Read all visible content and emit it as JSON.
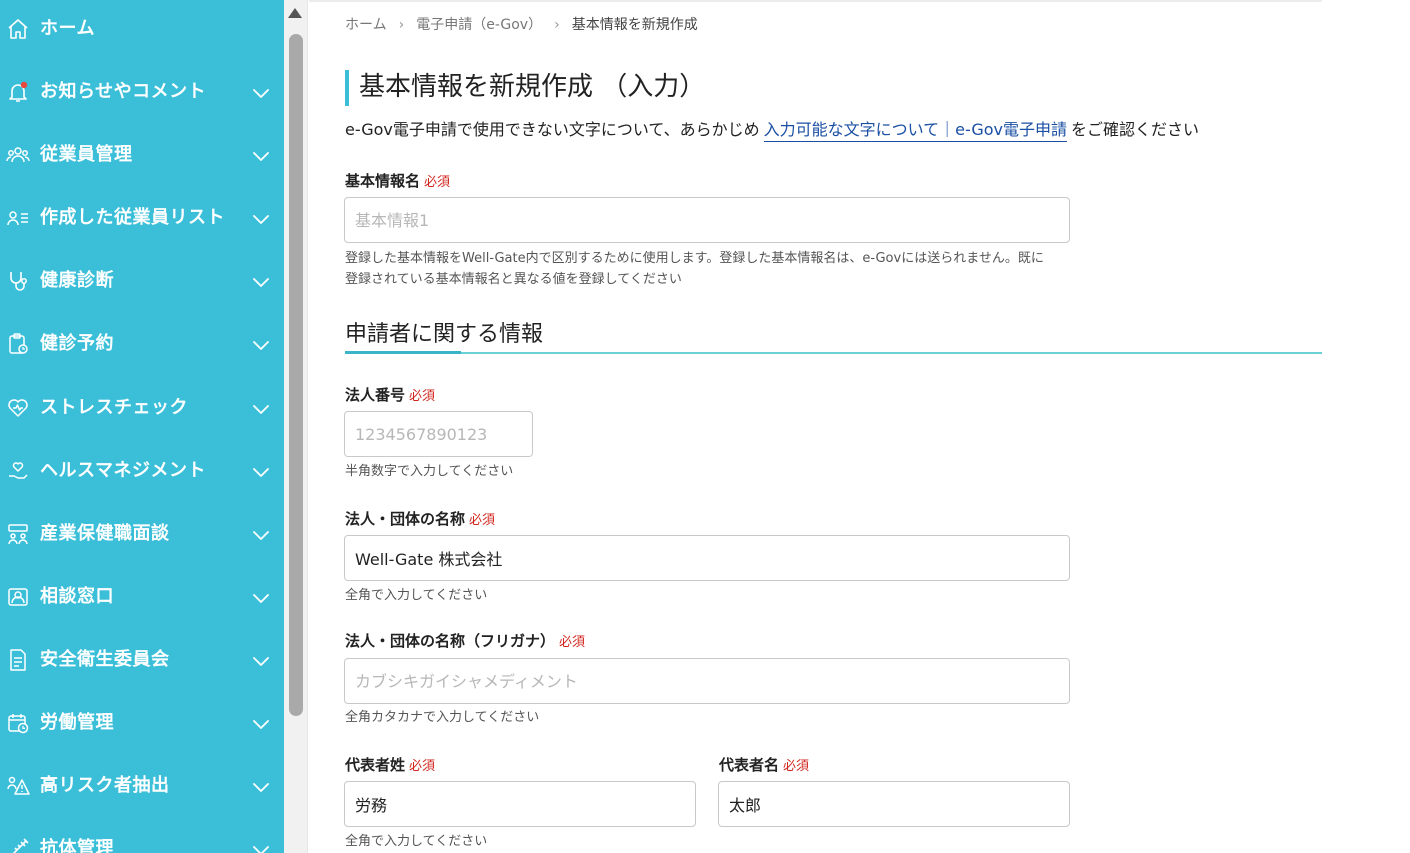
{
  "sidebar": {
    "items": [
      {
        "label": "ホーム",
        "icon": "home-icon"
      },
      {
        "label": "お知らせやコメント",
        "icon": "bell-icon"
      },
      {
        "label": "従業員管理",
        "icon": "users-icon"
      },
      {
        "label": "作成した従業員リスト",
        "icon": "user-list-icon"
      },
      {
        "label": "健康診断",
        "icon": "stethoscope-icon"
      },
      {
        "label": "健診予約",
        "icon": "clipboard-icon"
      },
      {
        "label": "ストレスチェック",
        "icon": "heart-icon"
      },
      {
        "label": "ヘルスマネジメント",
        "icon": "hand-heart-icon"
      },
      {
        "label": "産業保健職面談",
        "icon": "meeting-icon"
      },
      {
        "label": "相談窓口",
        "icon": "contact-icon"
      },
      {
        "label": "安全衛生委員会",
        "icon": "document-icon"
      },
      {
        "label": "労働管理",
        "icon": "calendar-clock-icon"
      },
      {
        "label": "高リスク者抽出",
        "icon": "warning-person-icon"
      },
      {
        "label": "抗体管理",
        "icon": "syringe-icon"
      }
    ]
  },
  "breadcrumb": {
    "home": "ホーム",
    "egov": "電子申請（e-Gov）",
    "current": "基本情報を新規作成",
    "separator": "›"
  },
  "page": {
    "title": "基本情報を新規作成 （入力）",
    "intro_before": "e-Gov電子申請で使用できない文字について、あらかじめ",
    "intro_link": "入力可能な文字について｜e-Gov電子申請",
    "intro_after": "をご確認ください"
  },
  "required_label": "必須",
  "form": {
    "basic_name": {
      "label": "基本情報名",
      "placeholder": "基本情報1",
      "value": "",
      "hint": "登録した基本情報をWell-Gate内で区別するために使用します。登録した基本情報名は、e-Govには送られません。既に登録されている基本情報名と異なる値を登録してください"
    },
    "section_title": "申請者に関する情報",
    "corporate_number": {
      "label": "法人番号",
      "placeholder": "1234567890123",
      "value": "",
      "hint": "半角数字で入力してください"
    },
    "corporate_name": {
      "label": "法人・団体の名称",
      "placeholder": "",
      "value": "Well-Gate 株式会社",
      "hint": "全角で入力してください"
    },
    "corporate_name_kana": {
      "label": "法人・団体の名称（フリガナ）",
      "placeholder": "カブシキガイシャメディメント",
      "value": "",
      "hint": "全角カタカナで入力してください"
    },
    "rep_last_name": {
      "label": "代表者姓",
      "value": "労務",
      "hint": "全角で入力してください"
    },
    "rep_first_name": {
      "label": "代表者名",
      "value": "太郎"
    }
  },
  "colors": {
    "sidebar_bg": "#3bbfd9",
    "accent": "#3bbfd9",
    "required": "#d1261e",
    "link": "#1a4fa3"
  }
}
